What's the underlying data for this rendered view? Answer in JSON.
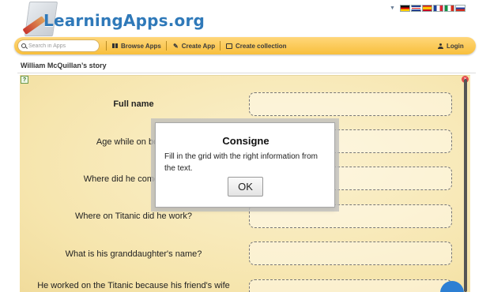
{
  "header": {
    "logo_text": "LearningApps.org",
    "flags": [
      "German flag",
      "British flag",
      "Spanish flag",
      "French flag",
      "Italian flag",
      "Russian flag"
    ]
  },
  "nav": {
    "search_placeholder": "Search in Apps",
    "browse_label": "Browse Apps",
    "create_label": "Create App",
    "collection_label": "Create collection",
    "login_label": "Login"
  },
  "page": {
    "title": "William McQuillan’s story"
  },
  "questions": [
    {
      "label": "Full name"
    },
    {
      "label": "Age while on board"
    },
    {
      "label": "Where did he come from?"
    },
    {
      "label": "Where on Titanic did he work?"
    },
    {
      "label": "What is his granddaughter's name?"
    },
    {
      "label": "He worked on the Titanic because his friend's wife"
    }
  ],
  "dialog": {
    "title": "Consigne",
    "text": "Fill in the grid with the right information from the text.",
    "ok_label": "OK"
  },
  "colors": {
    "nav_bar": "#f8bf3c",
    "logo_blue": "#2f79b9",
    "app_background": "#f6e5ad"
  }
}
